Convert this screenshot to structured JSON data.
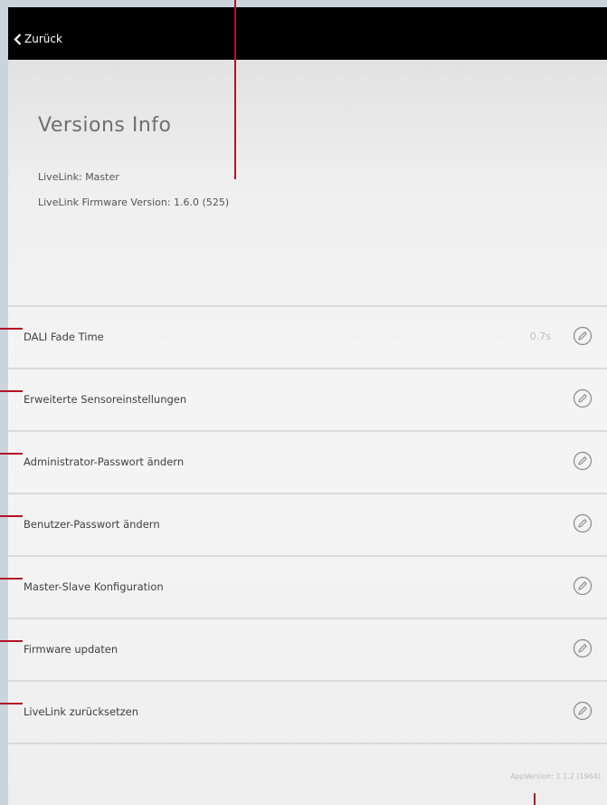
{
  "navbar": {
    "back_label": "Zurück"
  },
  "title": "Versions Info",
  "info": {
    "livelink": "LiveLink: Master",
    "firmware": "LiveLink Firmware Version: 1.6.0 (525)"
  },
  "settings": [
    {
      "label": "DALI Fade Time",
      "value": "0.7s"
    },
    {
      "label": "Erweiterte Sensoreinstellungen",
      "value": ""
    },
    {
      "label": "Administrator-Passwort ändern",
      "value": ""
    },
    {
      "label": "Benutzer-Passwort ändern",
      "value": ""
    },
    {
      "label": "Master-Slave Konfiguration",
      "value": ""
    },
    {
      "label": "Firmware updaten",
      "value": ""
    },
    {
      "label": "LiveLink zurücksetzen",
      "value": ""
    }
  ],
  "app_version": "AppVersion: 1.1.2 (1964)",
  "colors": {
    "navbar": "#000000",
    "callout": "#b3122a"
  },
  "icons": {
    "back": "chevron-left-icon",
    "edit": "pencil-circle-icon"
  }
}
